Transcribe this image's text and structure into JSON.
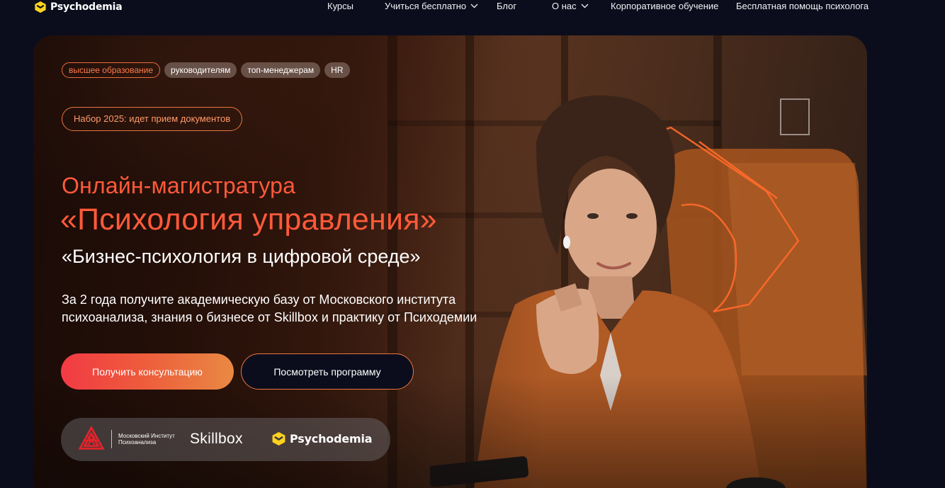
{
  "header": {
    "logo": "Psychodemia",
    "nav": [
      {
        "label": "Курсы",
        "has_dropdown": false
      },
      {
        "label": "Учиться бесплатно",
        "has_dropdown": true
      },
      {
        "label": "Блог",
        "has_dropdown": false
      },
      {
        "label": "О нас",
        "has_dropdown": true
      },
      {
        "label": "Корпоративное обучение",
        "has_dropdown": false
      },
      {
        "label": "Бесплатная помощь психолога",
        "has_dropdown": false
      }
    ]
  },
  "hero": {
    "tags": [
      "высшее образование",
      "руководителям",
      "топ-менеджерам",
      "HR"
    ],
    "badge": "Набор 2025: идет прием документов",
    "title_line1": "Онлайн-магистратура",
    "title_line2": "«Психология управления»",
    "subtitle": "«Бизнес-психология в цифровой среде»",
    "description": "За 2 года получите академическую базу от Московского института психоанализа, знания о бизнесе от Skillbox и практику от Психодемии",
    "primary_button": "Получить консультацию",
    "secondary_button": "Посмотреть программу",
    "partners": {
      "mip": "Московский Институт Психоанализа",
      "skillbox": "Skillbox",
      "psychodemia": "Psychodemia"
    }
  },
  "colors": {
    "background": "#0b0d1c",
    "accent_orange": "#ff5a3a",
    "logo_yellow": "#ffd21f",
    "button_gradient_start": "#f23a44",
    "button_gradient_end": "#e98943"
  },
  "icons": [
    "psychodemia-logo-icon",
    "chevron-down-icon",
    "mip-logo-icon",
    "woman-photo"
  ]
}
